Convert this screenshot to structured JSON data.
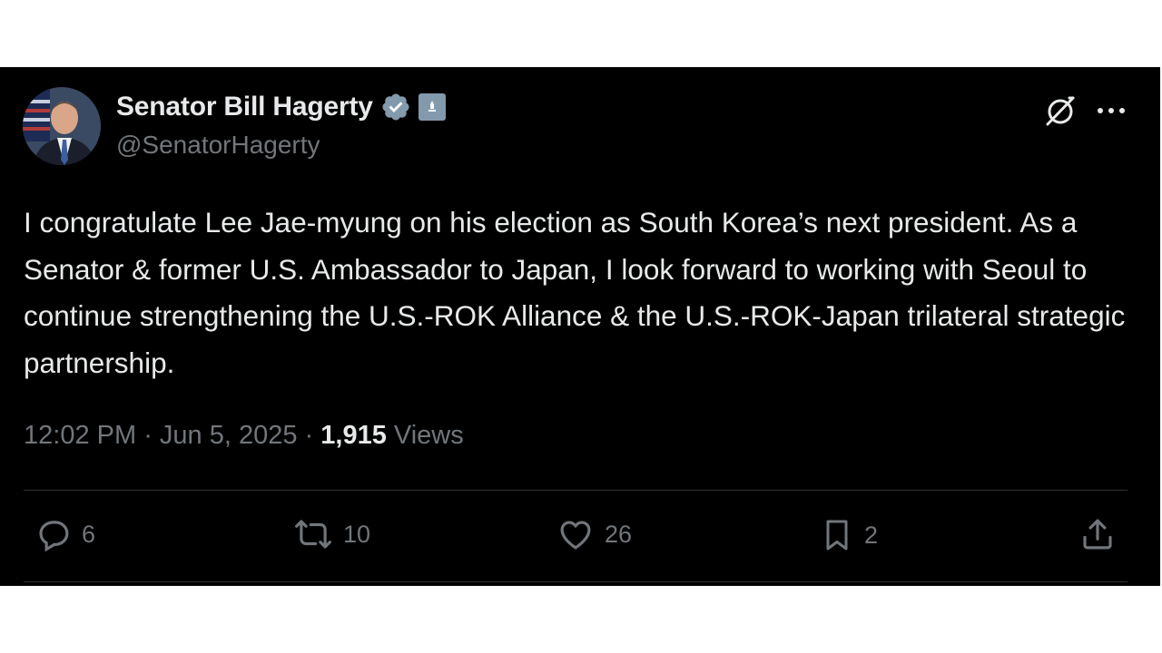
{
  "author": {
    "display_name": "Senator Bill Hagerty",
    "handle": "@SenatorHagerty"
  },
  "tweet": {
    "text": "I congratulate Lee Jae-myung on his election as South Korea’s next president. As a Senator & former U.S. Ambassador to Japan, I look forward to working with Seoul to continue strengthening the U.S.-ROK Alliance & the U.S.-ROK-Japan trilateral strategic partnership.",
    "time": "12:02 PM",
    "separator": " · ",
    "date": "Jun 5, 2025",
    "views_count": "1,915",
    "views_label": "Views"
  },
  "actions": {
    "replies": "6",
    "reposts": "10",
    "likes": "26",
    "bookmarks": "2"
  },
  "icons": {
    "verified": "verified-badge-icon",
    "government": "government-badge-icon",
    "grok": "grok-icon",
    "more": "more-icon",
    "reply": "reply-icon",
    "repost": "repost-icon",
    "like": "like-icon",
    "bookmark": "bookmark-icon",
    "share": "share-icon"
  },
  "colors": {
    "background": "#000000",
    "text": "#e7e9ea",
    "muted": "#71767b",
    "verified": "#829aab",
    "divider": "#2f3336"
  }
}
